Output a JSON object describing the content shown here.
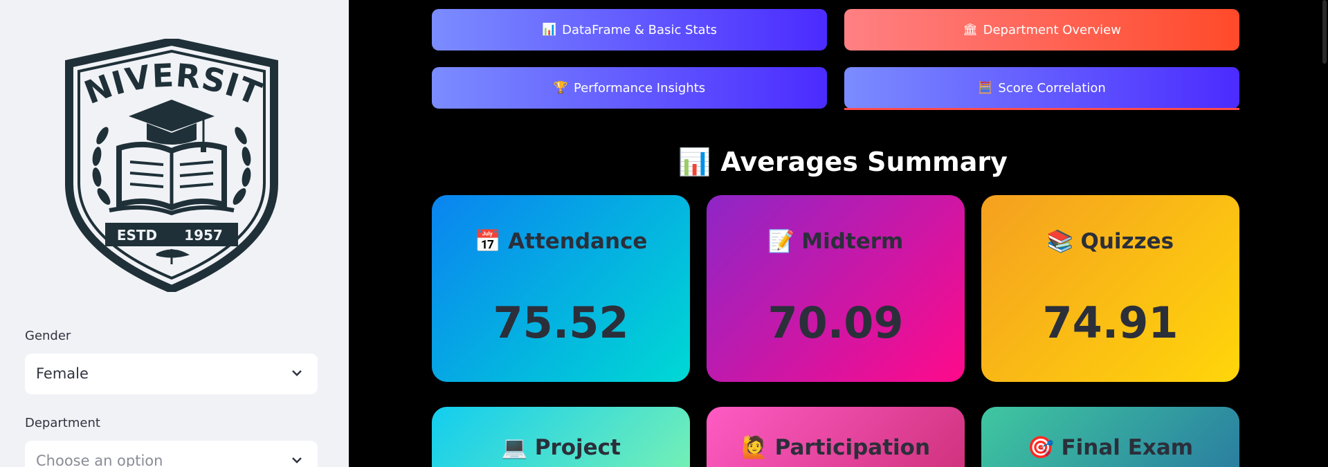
{
  "sidebar": {
    "logo": {
      "top_text": "UNIVERSITY",
      "estd_label": "ESTD",
      "estd_year": "1957",
      "color": "#1f3038"
    },
    "gender": {
      "label": "Gender",
      "value": "Female"
    },
    "department": {
      "label": "Department",
      "placeholder": "Choose an option"
    }
  },
  "nav": {
    "buttons": [
      {
        "icon": "📊",
        "label": "DataFrame & Basic Stats",
        "style": "blue"
      },
      {
        "icon": "🏛",
        "label": "Department Overview",
        "style": "red"
      },
      {
        "icon": "🏆",
        "label": "Performance Insights",
        "style": "blue"
      },
      {
        "icon": "🧮",
        "label": "Score Correlation",
        "style": "blue"
      }
    ]
  },
  "summary": {
    "title_icon": "📊",
    "title": "Averages Summary",
    "cards": [
      {
        "icon": "📅",
        "label": "Attendance",
        "value": "75.52",
        "gradient": [
          "#0a84f0",
          "#00d9d4"
        ]
      },
      {
        "icon": "📝",
        "label": "Midterm",
        "value": "70.09",
        "gradient": [
          "#8e26c7",
          "#ff0a8a"
        ]
      },
      {
        "icon": "📚",
        "label": "Quizzes",
        "value": "74.91",
        "gradient": [
          "#f5a020",
          "#ffd60a"
        ]
      },
      {
        "icon": "💻",
        "label": "Project",
        "value": "",
        "gradient": [
          "#12cdf0",
          "#74efb6"
        ]
      },
      {
        "icon": "🙋",
        "label": "Participation",
        "value": "",
        "gradient": [
          "#ff5bc4",
          "#d0337e"
        ]
      },
      {
        "icon": "🎯",
        "label": "Final Exam",
        "value": "",
        "gradient": [
          "#3fc7a0",
          "#2a7fa0"
        ]
      }
    ]
  }
}
